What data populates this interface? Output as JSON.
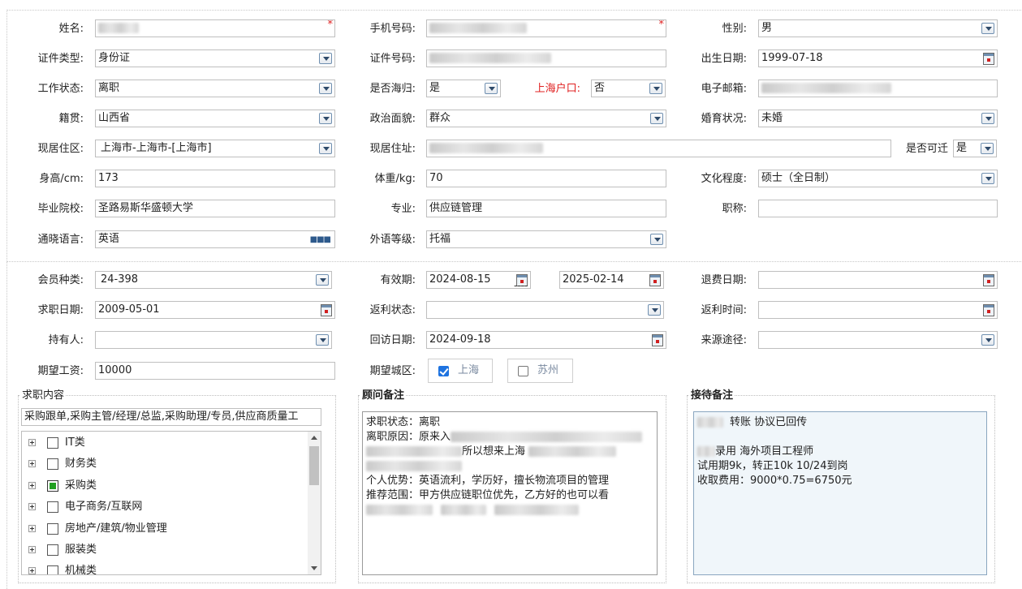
{
  "form": {
    "name_label": "姓名:",
    "phone_label": "手机号码:",
    "gender_label": "性别:",
    "gender_value": "男",
    "idtype_label": "证件类型:",
    "idtype_value": "身份证",
    "idno_label": "证件号码:",
    "birth_label": "出生日期:",
    "birth_value": "1999-07-18",
    "work_label": "工作状态:",
    "work_value": "离职",
    "overseas_label": "是否海归:",
    "overseas_value": "是",
    "hukou_label": "上海户口:",
    "hukou_value": "否",
    "email_label": "电子邮箱:",
    "native_label": "籍贯:",
    "native_value": "山西省",
    "political_label": "政治面貌:",
    "political_value": "群众",
    "marital_label": "婚育状况:",
    "marital_value": "未婚",
    "residence_label": "现居住区:",
    "residence_value": "上海市-上海市-[上海市]",
    "address_label": "现居住址:",
    "relocate_label": "是否可迁",
    "relocate_value": "是",
    "height_label": "身高/cm:",
    "height_value": "173",
    "weight_label": "体重/kg:",
    "weight_value": "70",
    "edu_label": "文化程度:",
    "edu_value": "硕士（全日制）",
    "school_label": "毕业院校:",
    "school_value": "圣路易斯华盛顿大学",
    "major_label": "专业:",
    "major_value": "供应链管理",
    "title_label": "职称:",
    "lang_label": "通晓语言:",
    "lang_value": "英语",
    "level_label": "外语等级:",
    "level_value": "托福"
  },
  "member": {
    "type_label": "会员种类:",
    "type_value": "24-398",
    "valid_label": "有效期:",
    "valid_from": "2024-08-15",
    "valid_sep": "----",
    "valid_to": "2025-02-14",
    "refund_label": "退费日期:",
    "jobdate_label": "求职日期:",
    "jobdate_value": "2009-05-01",
    "rebate_label": "返利状态:",
    "rebatetime_label": "返利时间:",
    "holder_label": "持有人:",
    "visit_label": "回访日期:",
    "visit_value": "2024-09-18",
    "source_label": "来源途径:",
    "salary_label": "期望工资:",
    "salary_value": "10000",
    "city_label": "期望城区:",
    "city_options": [
      "上海",
      "苏州"
    ]
  },
  "job": {
    "title": "求职内容",
    "summary": "采购跟单,采购主管/经理/总监,采购助理/专员,供应商质量工",
    "tree": [
      "IT类",
      "财务类",
      "采购类",
      "电子商务/互联网",
      "房地产/建筑/物业管理",
      "服装类",
      "机械类"
    ]
  },
  "advisor": {
    "title": "顾问备注",
    "l1": "求职状态：离职",
    "l2": "离职原因：原来入",
    "l3": "所以想来上海",
    "l5": "个人优势：英语流利，学历好，擅长物流项目的管理",
    "l6": "推荐范围：甲方供应链职位优先，乙方好的也可以看"
  },
  "reception": {
    "title": "接待备注",
    "l1": "转账  协议已回传",
    "l3": "录用 海外项目工程师",
    "l4": "试用期9k，转正10k 10/24到岗",
    "l5": "收取费用：9000*0.75=6750元"
  }
}
